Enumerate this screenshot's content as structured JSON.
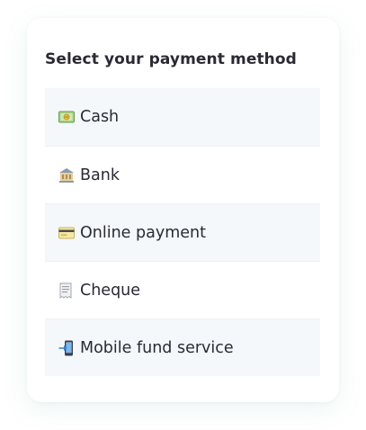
{
  "title": "Select your payment method",
  "options": [
    {
      "label": "Cash",
      "icon": "cash-icon",
      "shaded": true
    },
    {
      "label": "Bank",
      "icon": "bank-icon",
      "shaded": false
    },
    {
      "label": "Online payment",
      "icon": "credit-card-icon",
      "shaded": true
    },
    {
      "label": "Cheque",
      "icon": "receipt-icon",
      "shaded": false
    },
    {
      "label": "Mobile fund service",
      "icon": "mobile-arrow-icon",
      "shaded": true
    }
  ],
  "colors": {
    "text": "#2a2a33",
    "row_shaded": "#f4f8fb",
    "divider": "#edf1f5",
    "card": "#ffffff"
  }
}
